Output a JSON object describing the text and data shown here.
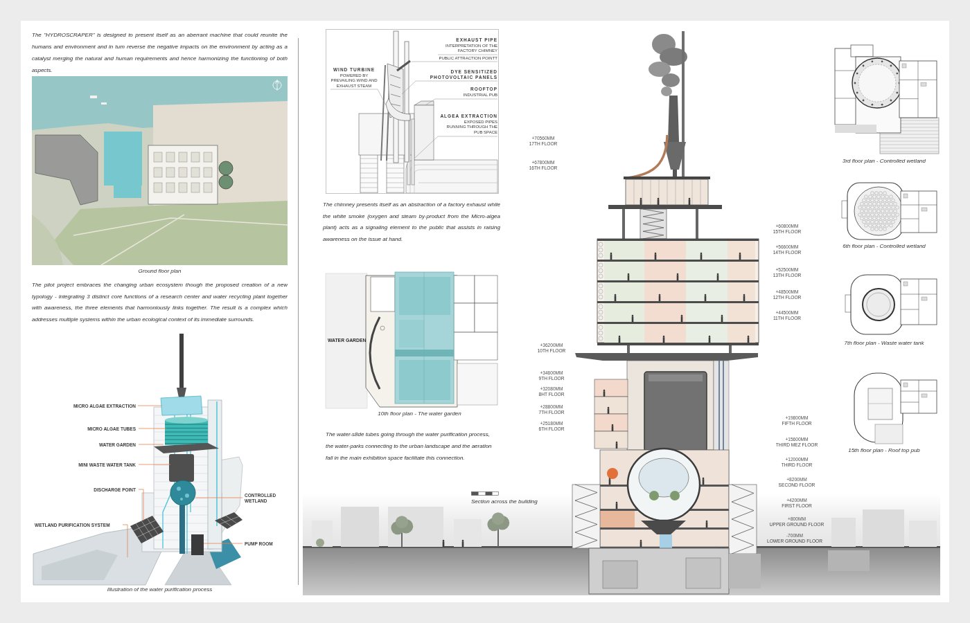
{
  "intro_text": "The \"HYDROSCRAPER\" is designed to present itself as an aberrant machine that could reunite the humans and environment and in turn reverse the negative impacts on the environment by acting as a catalyst merging the natural and human requirements and hence harmonizing the functioning of both aspects.",
  "site_plan": {
    "caption": "Ground floor plan"
  },
  "project_text": "The pilot project embraces the changing urban ecosystem though the proposed creation of a new typology - integrating 3 distinct core functions of a research center and water recycling plant together with awareness, the three elements that harmoniously links together. The result is a complex which addresses multiple systems within the urban ecological context of its immediate surrounds.",
  "purification_illustration": {
    "labels": [
      "MICRO ALGAE EXTRACTION",
      "MICRO ALGAE TUBES",
      "WATER GARDEN",
      "MINI WASTE WATER TANK",
      "DISCHARGE POINT",
      "WETLAND PURIFICATION SYSTEM",
      "CONTROLLED WETLAND",
      "PUMP ROOM"
    ],
    "caption": "Illustration of the water purification process"
  },
  "chimney_detail": {
    "labels": [
      {
        "lines": [
          {
            "text": "EXHAUST PIPE",
            "kind": "title"
          },
          {
            "text": "INTERPRETATION OF THE",
            "kind": "detail"
          },
          {
            "text": "FACTORY CHIMNEY",
            "kind": "detail"
          }
        ]
      },
      {
        "lines": [
          {
            "text": "PUBLIC ATTRACTION POINTT",
            "kind": "detail"
          }
        ]
      },
      {
        "lines": [
          {
            "text": "WIND TURBINE",
            "kind": "title"
          },
          {
            "text": "POWERED BY",
            "kind": "detail"
          },
          {
            "text": "PREVAILING WIND AND",
            "kind": "detail"
          },
          {
            "text": "EXHAUST STEAM",
            "kind": "detail"
          }
        ]
      },
      {
        "lines": [
          {
            "text": "DYE SENSITIZED",
            "kind": "title"
          },
          {
            "text": "PHOTOVOLTAIC PANELS",
            "kind": "title"
          }
        ]
      },
      {
        "lines": [
          {
            "text": "ROOFTOP",
            "kind": "title"
          },
          {
            "text": "INDUSTRIAL PUB",
            "kind": "detail"
          }
        ]
      },
      {
        "lines": [
          {
            "text": "ALGEA EXTRACTION",
            "kind": "title"
          },
          {
            "text": "EXPOSED PIPES",
            "kind": "detail"
          },
          {
            "text": "RUNNING THROUGH THE",
            "kind": "detail"
          },
          {
            "text": "PUB SPACE",
            "kind": "detail"
          }
        ]
      }
    ]
  },
  "chimney_text": "The chimney presents itself as an abstraction of a factory exhaust while the white smoke (oxygen and steam by-product from the Micro-algea plant) acts as a signaling element to the public that assists in raising awareness on the issue at hand.",
  "tenth_floor_plan": {
    "room_label": "WATER GARDEN",
    "caption": "10th floor plan - The water garden"
  },
  "water_text": "The water-s8de tubes going through the water purification process, the water-parks connecting to the urban landscape and the aeration fall in the main exhibition space facilitate this connection.",
  "section": {
    "caption": "Section across the building",
    "levels": [
      {
        "elevation": "+70560MM",
        "floor": "17TH FLOOR"
      },
      {
        "elevation": "+67800MM",
        "floor": "16TH FLOOR"
      },
      {
        "elevation": "+60800MM",
        "floor": "15TH FLOOR"
      },
      {
        "elevation": "+56600MM",
        "floor": "14TH FLOOR"
      },
      {
        "elevation": "+52500MM",
        "floor": "13TH FLOOR"
      },
      {
        "elevation": "+48500MM",
        "floor": "12TH FLOOR"
      },
      {
        "elevation": "+44500MM",
        "floor": "11TH FLOOR"
      },
      {
        "elevation": "+36200MM",
        "floor": "10TH FLOOR"
      },
      {
        "elevation": "+34600MM",
        "floor": "9TH FLOOR"
      },
      {
        "elevation": "+32080MM",
        "floor": "8HT FLOOR"
      },
      {
        "elevation": "+28800MM",
        "floor": "7TH FLOOR"
      },
      {
        "elevation": "+25180MM",
        "floor": "6TH FLOOR"
      },
      {
        "elevation": "+19800MM",
        "floor": "FIFTH FLOOR"
      },
      {
        "elevation": "+15600MM",
        "floor": "THIRD MEZ FLOOR"
      },
      {
        "elevation": "+12000MM",
        "floor": "THIRD FLOOR"
      },
      {
        "elevation": "+8200MM",
        "floor": "SECOND FLOOR"
      },
      {
        "elevation": "+4200MM",
        "floor": "FIRST FLOOR"
      },
      {
        "elevation": "+800MM",
        "floor": "UPPER GROUND FLOOR"
      },
      {
        "elevation": "-700MM",
        "floor": "LOWER GROUND FLOOR"
      }
    ]
  },
  "floor_plans": [
    {
      "kind": "dome",
      "caption": "3rd floor plan - Controlled wetland"
    },
    {
      "kind": "lattice",
      "caption": "6th floor plan - Controlled wetland"
    },
    {
      "kind": "tank",
      "caption": "7th floor plan - Waste water tank"
    },
    {
      "kind": "roof",
      "caption": "15th floor plan - Roof top pub"
    }
  ]
}
